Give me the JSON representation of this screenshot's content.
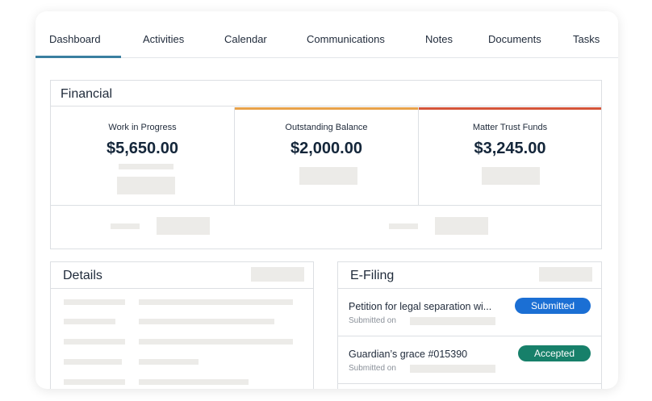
{
  "tabs": [
    {
      "label": "Dashboard",
      "active": true
    },
    {
      "label": "Activities"
    },
    {
      "label": "Calendar"
    },
    {
      "label": "Communications"
    },
    {
      "label": "Notes"
    },
    {
      "label": "Documents"
    },
    {
      "label": "Tasks"
    }
  ],
  "financial": {
    "title": "Financial",
    "metrics": [
      {
        "label": "Work in Progress",
        "value": "$5,650.00"
      },
      {
        "label": "Outstanding Balance",
        "value": "$2,000.00",
        "accent": "#e8a24a"
      },
      {
        "label": "Matter Trust Funds",
        "value": "$3,245.00",
        "accent": "#d4553a"
      }
    ]
  },
  "details": {
    "title": "Details"
  },
  "efiling": {
    "title": "E-Filing",
    "rows": [
      {
        "name": "Petition for legal separation wi...",
        "sub": "Submitted on",
        "status": "Submitted",
        "status_color": "#1b6fd4"
      },
      {
        "name": "Guardian’s grace #015390",
        "sub": "Submitted on",
        "status": "Accepted",
        "status_color": "#17806a"
      }
    ]
  },
  "colors": {
    "tab_underline": "#3a7fa0",
    "placeholder": "#ecebe8",
    "border": "#dcdfe3"
  }
}
